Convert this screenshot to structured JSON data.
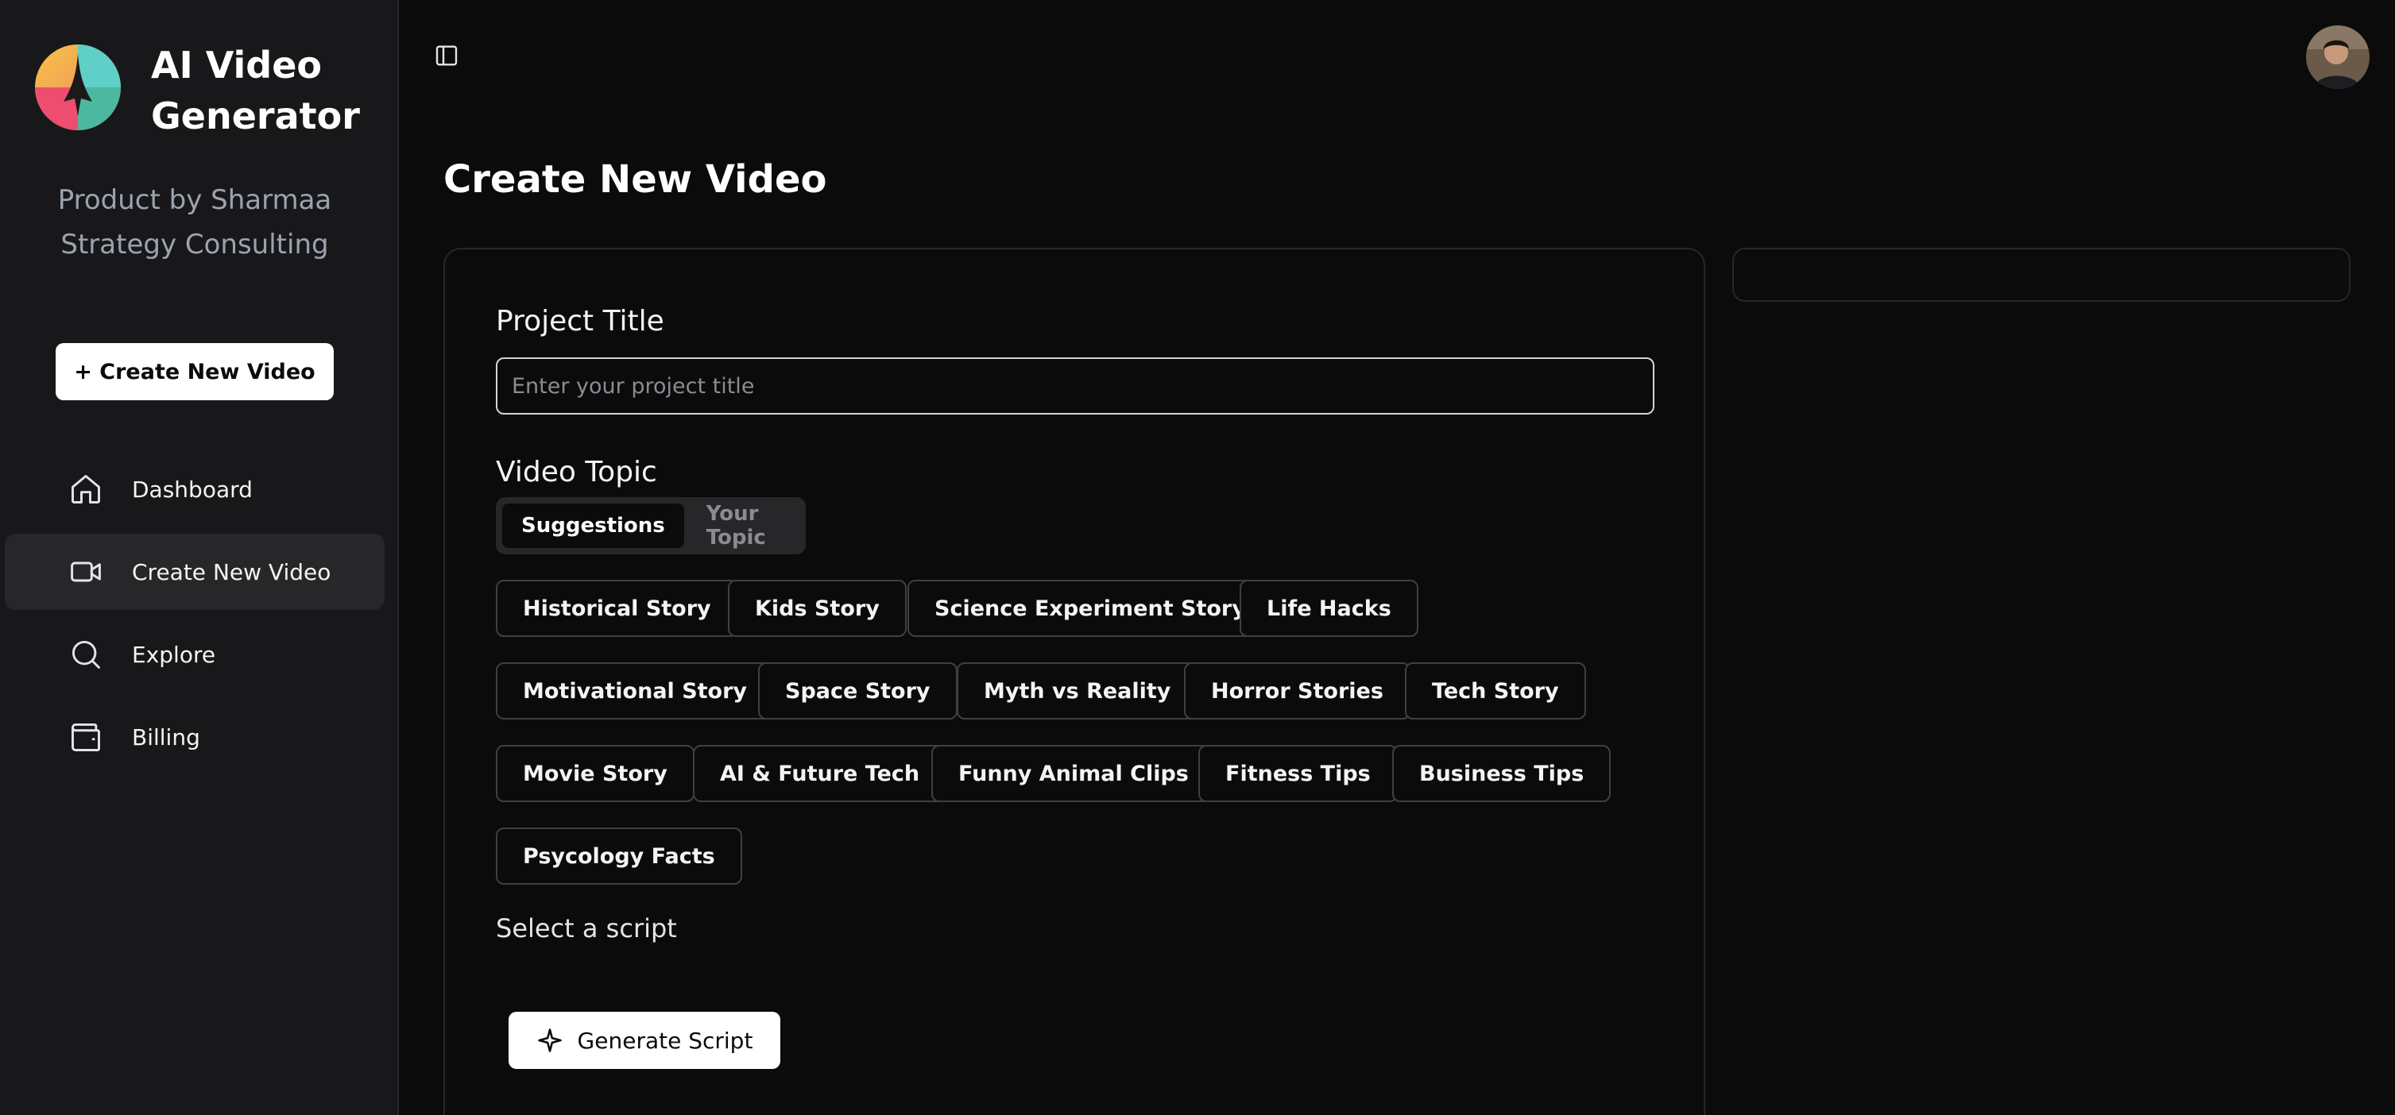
{
  "brand": {
    "name": "AI Video Generator",
    "tagline": "Product by Sharmaa Strategy Consulting"
  },
  "sidebar": {
    "create_button": "+ Create New Video",
    "items": [
      {
        "label": "Dashboard",
        "icon": "home-icon",
        "active": false
      },
      {
        "label": "Create New Video",
        "icon": "video-camera-icon",
        "active": true
      },
      {
        "label": "Explore",
        "icon": "search-icon",
        "active": false
      },
      {
        "label": "Billing",
        "icon": "wallet-icon",
        "active": false
      }
    ]
  },
  "header": {
    "toggle_icon": "sidebar-toggle-icon",
    "avatar": "user-avatar"
  },
  "main": {
    "title": "Create New Video",
    "project_title": {
      "label": "Project Title",
      "value": "",
      "placeholder": "Enter your project title"
    },
    "video_topic": {
      "label": "Video Topic",
      "tabs": [
        {
          "label": "Suggestions",
          "active": true
        },
        {
          "label": "Your Topic",
          "active": false
        }
      ],
      "suggestions": [
        "Historical Story",
        "Kids Story",
        "Science Experiment Story",
        "Life Hacks",
        "Motivational Story",
        "Space Story",
        "Myth vs Reality",
        "Horror Stories",
        "Tech Story",
        "Movie Story",
        "AI & Future Tech",
        "Funny Animal Clips",
        "Fitness Tips",
        "Business Tips",
        "Psycology Facts"
      ]
    },
    "script": {
      "label": "Select a script",
      "generate_button": "Generate Script"
    }
  },
  "colors": {
    "background": "#0b0b0c",
    "sidebar": "#18181b",
    "active_item": "#27272a",
    "border": "#3f3f46",
    "muted_text": "#9ca3af",
    "button_bg": "#ffffff"
  }
}
